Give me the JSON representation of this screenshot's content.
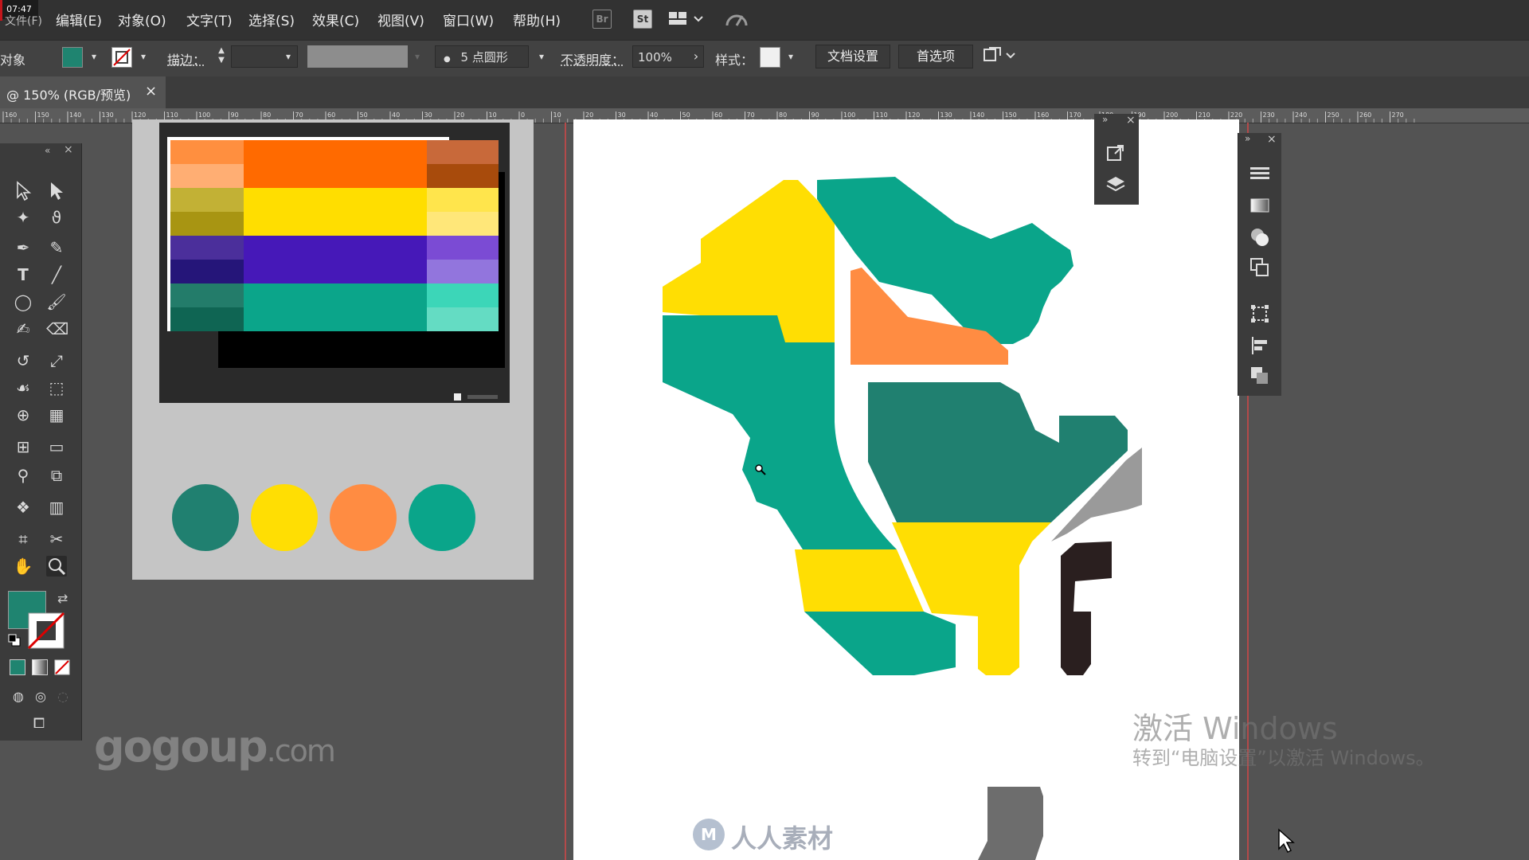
{
  "clock": "07:47",
  "menu": [
    "编辑(E)",
    "对象(O)",
    "文字(T)",
    "选择(S)",
    "效果(C)",
    "视图(V)",
    "窗口(W)",
    "帮助(H)"
  ],
  "menu_partial": "文件(F)",
  "bridge_icons": {
    "br": "Br",
    "st": "St"
  },
  "control": {
    "object_label": "对象",
    "stroke_label": "描边：",
    "brush_label": "5 点圆形",
    "opacity_label": "不透明度：",
    "opacity_value": "100%",
    "style_label": "样式：",
    "doc_setup": "文档设置",
    "preferences": "首选项"
  },
  "tab": {
    "title": "@ 150% (RGB/预览)",
    "close": "×"
  },
  "ruler_labels": [
    "160",
    "150",
    "140",
    "130",
    "120",
    "110",
    "100",
    "90",
    "80",
    "70",
    "60",
    "50",
    "40",
    "30",
    "20",
    "10",
    "0",
    "10",
    "20",
    "30",
    "40",
    "50",
    "60",
    "70",
    "80",
    "90",
    "100",
    "110",
    "120",
    "130",
    "140",
    "150",
    "160",
    "170",
    "180",
    "190",
    "200",
    "210",
    "220",
    "230",
    "240",
    "250",
    "260",
    "270"
  ],
  "colors": {
    "fill": "#1f8470",
    "teal_dark": "#208070",
    "teal": "#0aa58a",
    "yellow": "#ffde03",
    "orange": "#ff8c42",
    "dark_brown": "#2a1f1f",
    "gray": "#9a9a9a"
  },
  "palette_rows": [
    {
      "left": [
        "#ff8f3f",
        "#ffae73"
      ],
      "main": "#ff6a00",
      "right": [
        "#c8693a",
        "#a84b0c"
      ]
    },
    {
      "left": [
        "#c2b135",
        "#a89512"
      ],
      "main": "#ffde00",
      "right": [
        "#ffe54c",
        "#ffe779"
      ]
    },
    {
      "left": [
        "#4b2f9b",
        "#251579"
      ],
      "main": "#4618b8",
      "right": [
        "#7b4bd4",
        "#9275dd"
      ]
    },
    {
      "left": [
        "#237c6a",
        "#0f6553"
      ],
      "main": "#0ba58a",
      "right": [
        "#3cd6b8",
        "#64dcc3"
      ]
    }
  ],
  "swatch_circles": [
    "#208070",
    "#ffde03",
    "#ff8c42",
    "#0aa58a"
  ],
  "watermarks": {
    "gogoup": "gogoup",
    "gogoup_suffix": ".com",
    "windows_title": "激活 Windows",
    "windows_sub": "转到“电脑设置”以激活 Windows。",
    "renren": "人人素材"
  }
}
